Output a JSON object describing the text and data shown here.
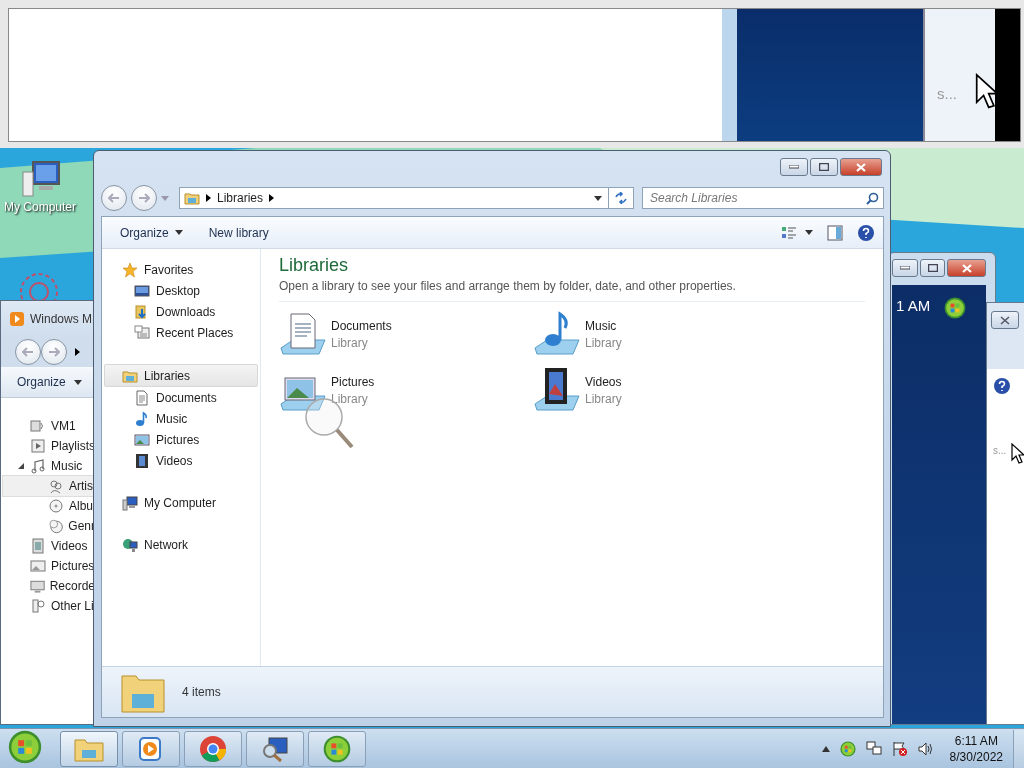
{
  "top_preview": {
    "text": "s..."
  },
  "desktop_icons": [
    {
      "label": "My Computer"
    }
  ],
  "media_player": {
    "title": "Windows M",
    "toolbar": [
      "Organize"
    ],
    "tree": [
      {
        "label": "VM1",
        "selected": false,
        "expanded": false
      },
      {
        "label": "Playlists",
        "selected": false,
        "expanded": false
      },
      {
        "label": "Music",
        "selected": false,
        "expanded": true,
        "children": [
          {
            "label": "Artis",
            "selected": true
          },
          {
            "label": "Albu",
            "selected": false
          },
          {
            "label": "Genr",
            "selected": false
          }
        ]
      },
      {
        "label": "Videos",
        "selected": false,
        "expanded": false
      },
      {
        "label": "Pictures",
        "selected": false,
        "expanded": false
      },
      {
        "label": "Recorde",
        "selected": false,
        "expanded": false
      },
      {
        "label": "Other Li",
        "selected": false,
        "expanded": false
      }
    ]
  },
  "back_window": {
    "time_text": "1 AM"
  },
  "side_window": {
    "text": "s..."
  },
  "explorer": {
    "address": [
      "Libraries"
    ],
    "search": {
      "placeholder": "Search Libraries"
    },
    "toolbar": [
      {
        "label": "Organize",
        "kind": "menu"
      },
      {
        "label": "New library",
        "kind": "button"
      }
    ],
    "nav": [
      {
        "label": "Favorites",
        "selected": false,
        "children": [
          {
            "label": "Desktop"
          },
          {
            "label": "Downloads"
          },
          {
            "label": "Recent Places"
          }
        ]
      },
      {
        "label": "Libraries",
        "selected": true,
        "children": [
          {
            "label": "Documents"
          },
          {
            "label": "Music"
          },
          {
            "label": "Pictures"
          },
          {
            "label": "Videos"
          }
        ]
      },
      {
        "label": "My Computer",
        "selected": false
      },
      {
        "label": "Network",
        "selected": false
      }
    ],
    "heading": "Libraries",
    "description": "Open a library to see your files and arrange them by folder, date, and other properties.",
    "libraries": [
      {
        "name": "Documents",
        "subtitle": "Library",
        "kind": "documents"
      },
      {
        "name": "Music",
        "subtitle": "Library",
        "kind": "music"
      },
      {
        "name": "Pictures",
        "subtitle": "Library",
        "kind": "pictures"
      },
      {
        "name": "Videos",
        "subtitle": "Library",
        "kind": "videos"
      }
    ],
    "status": "4 items"
  },
  "taskbar": {
    "apps": [
      {
        "selected": true
      },
      {
        "selected": false
      },
      {
        "selected": false
      },
      {
        "selected": false
      },
      {
        "selected": false
      }
    ],
    "time": "6:11 AM",
    "date": "8/30/2022"
  }
}
